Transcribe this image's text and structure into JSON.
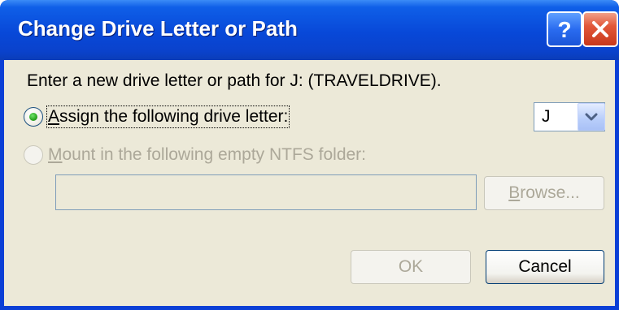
{
  "window": {
    "title": "Change Drive Letter or Path",
    "help_glyph": "?",
    "close_glyph": "✕",
    "colors": {
      "titlebar": "#0848d8",
      "client": "#ece9d8",
      "close": "#e2583a"
    }
  },
  "prompt": "Enter a new drive letter or path for J: (TRAVELDRIVE).",
  "options": {
    "assign_letter": {
      "mnemonic": "A",
      "rest": "ssign the following drive letter:",
      "selected": true
    },
    "mount_folder": {
      "mnemonic": "M",
      "rest": "ount in the following empty NTFS folder:",
      "selected": false,
      "enabled": false
    }
  },
  "drive_letter": {
    "value": "J"
  },
  "folder_path": {
    "value": ""
  },
  "buttons": {
    "browse": {
      "mnemonic": "B",
      "rest": "rowse...",
      "enabled": false
    },
    "ok": {
      "label": "OK",
      "enabled": false
    },
    "cancel": {
      "label": "Cancel",
      "enabled": true
    }
  },
  "icons": {
    "help": "help-icon",
    "close": "close-icon",
    "dropdown": "chevron-down-icon"
  }
}
